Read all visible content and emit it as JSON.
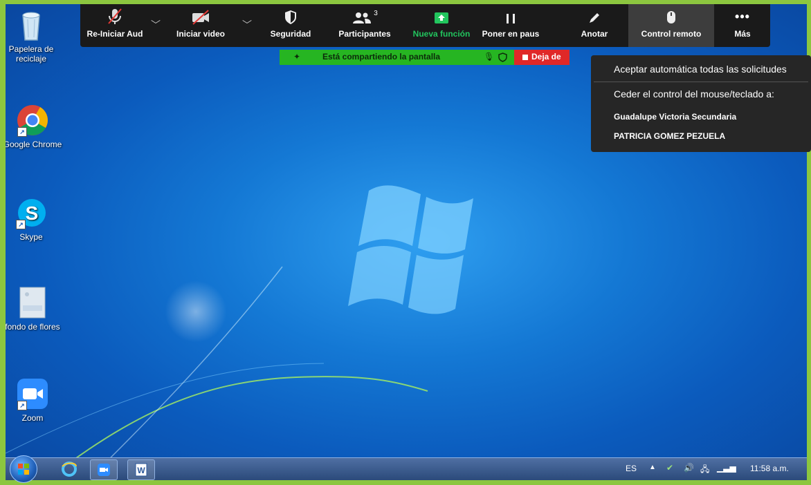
{
  "desktop": {
    "icons": [
      {
        "label": "Papelera de\nreciclaje",
        "icon": "recycle-bin-icon"
      },
      {
        "label": "Google Chrome",
        "icon": "chrome-icon"
      },
      {
        "label": "Skype",
        "icon": "skype-icon"
      },
      {
        "label": "fondo de flores",
        "icon": "image-file-icon"
      },
      {
        "label": "Zoom",
        "icon": "zoom-icon"
      }
    ]
  },
  "toolbar": {
    "audio_label": "Re-Iniciar Aud",
    "video_label": "Iniciar video",
    "security_label": "Seguridad",
    "participants_label": "Participantes",
    "participants_count": "3",
    "new_share_label": "Nueva función",
    "pause_label": "Poner en paus",
    "annotate_label": "Anotar",
    "remote_control_label": "Control remoto",
    "more_label": "Más"
  },
  "share_banner": {
    "text": "Está compartiendo la pantalla",
    "stop_label": "Deja de"
  },
  "remote_menu": {
    "auto_accept": "Aceptar automática todas las solicitudes",
    "give_control": "Ceder el control del mouse/teclado a:",
    "participants": [
      "Guadalupe Victoria Secundaria",
      "PATRICIA GOMEZ PEZUELA"
    ]
  },
  "taskbar": {
    "language": "ES",
    "time": "11:58 a.m."
  },
  "colors": {
    "toolbar_bg": "#1a1a1a",
    "share_green": "#26b522",
    "stop_red": "#e02828",
    "accent_green": "#22c55e"
  }
}
